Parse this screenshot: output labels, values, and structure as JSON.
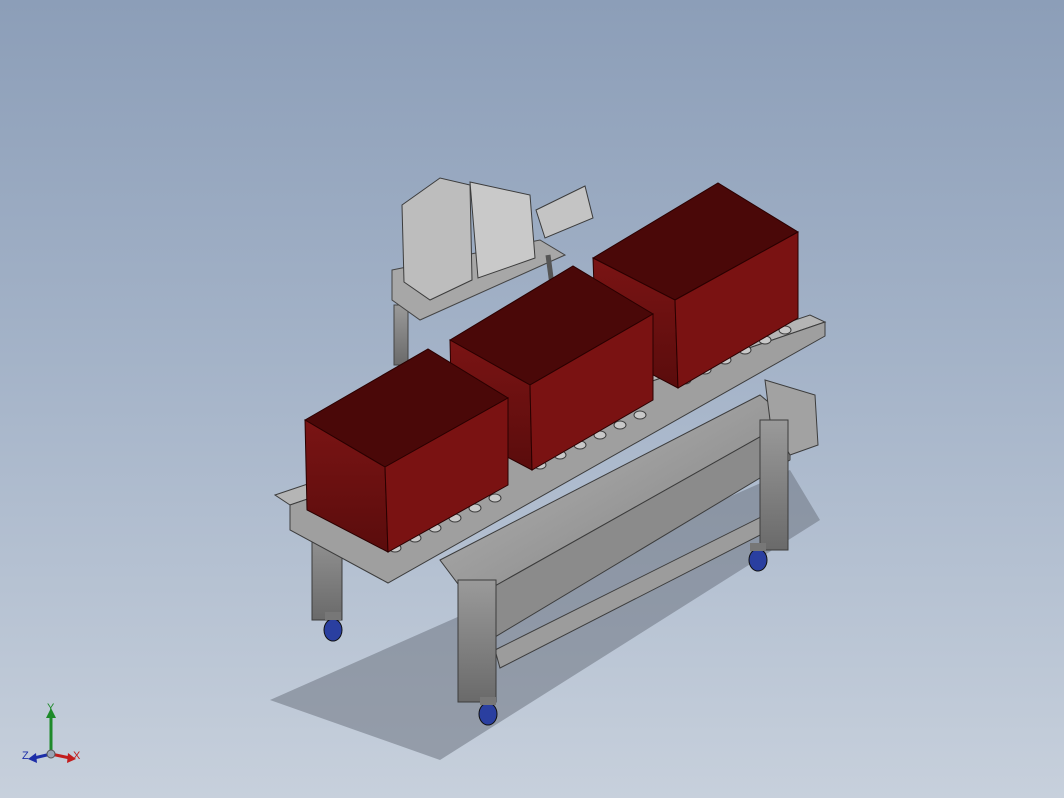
{
  "viewport": {
    "background_top": "#8c9eb8",
    "background_bottom": "#c7d0dc"
  },
  "model": {
    "bin_color": "#6b0f0f",
    "bin_inner_color": "#4a0808",
    "frame_color": "#8e8e8e",
    "caster_color": "#2a3fa0"
  },
  "triad": {
    "x_label": "X",
    "y_label": "Y",
    "z_label": "Z",
    "x_color": "#c21d1d",
    "y_color": "#1e8a2a",
    "z_color": "#1d2ea8"
  }
}
